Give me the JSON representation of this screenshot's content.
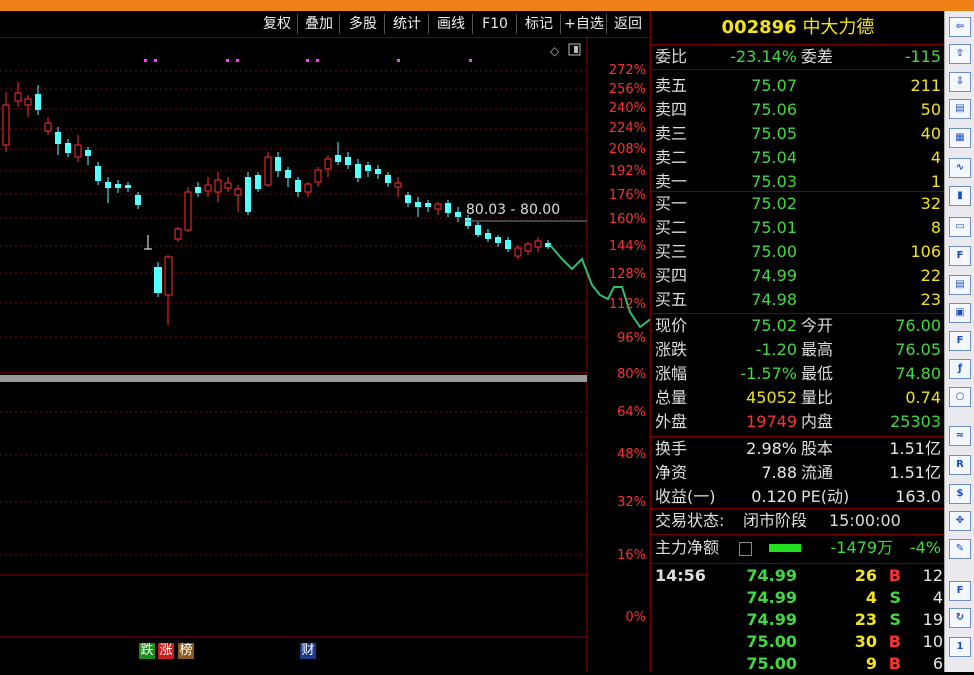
{
  "toolbar": {
    "buttons": [
      "复权",
      "叠加",
      "多股",
      "统计",
      "画线",
      "F10",
      "标记",
      "+自选",
      "返回"
    ]
  },
  "chart": {
    "price_label": "80.03 - 80.00",
    "axis_labels": [
      "272%",
      "256%",
      "240%",
      "224%",
      "208%",
      "192%",
      "176%",
      "160%",
      "144%",
      "128%",
      "112%",
      "96%",
      "80%",
      "64%",
      "48%",
      "32%",
      "16%",
      "0%"
    ],
    "markers": [
      "跌",
      "涨",
      "榜",
      "财"
    ]
  },
  "quote": {
    "code": "002896",
    "name": "中大力德",
    "weibi_label": "委比",
    "weibi_value": "-23.14%",
    "weicha_label": "委差",
    "weicha_value": "-115",
    "sells": [
      {
        "label": "卖五",
        "price": "75.07",
        "vol": "211"
      },
      {
        "label": "卖四",
        "price": "75.06",
        "vol": "50"
      },
      {
        "label": "卖三",
        "price": "75.05",
        "vol": "40"
      },
      {
        "label": "卖二",
        "price": "75.04",
        "vol": "4"
      },
      {
        "label": "卖一",
        "price": "75.03",
        "vol": "1"
      }
    ],
    "buys": [
      {
        "label": "买一",
        "price": "75.02",
        "vol": "32"
      },
      {
        "label": "买二",
        "price": "75.01",
        "vol": "8"
      },
      {
        "label": "买三",
        "price": "75.00",
        "vol": "106"
      },
      {
        "label": "买四",
        "price": "74.99",
        "vol": "22"
      },
      {
        "label": "买五",
        "price": "74.98",
        "vol": "23"
      }
    ],
    "stats": [
      {
        "l1": "现价",
        "v1": "75.02",
        "c1": "green",
        "l2": "今开",
        "v2": "76.00",
        "c2": "green"
      },
      {
        "l1": "涨跌",
        "v1": "-1.20",
        "c1": "green",
        "l2": "最高",
        "v2": "76.05",
        "c2": "green"
      },
      {
        "l1": "涨幅",
        "v1": "-1.57%",
        "c1": "green",
        "l2": "最低",
        "v2": "74.80",
        "c2": "green"
      },
      {
        "l1": "总量",
        "v1": "45052",
        "c1": "yellow",
        "l2": "量比",
        "v2": "0.74",
        "c2": "yellow"
      },
      {
        "l1": "外盘",
        "v1": "19749",
        "c1": "red",
        "l2": "内盘",
        "v2": "25303",
        "c2": "green"
      }
    ],
    "stats2": [
      {
        "l1": "换手",
        "v1": "2.98%",
        "l2": "股本",
        "v2": "1.51亿"
      },
      {
        "l1": "净资",
        "v1": "7.88",
        "l2": "流通",
        "v2": "1.51亿"
      },
      {
        "l1": "收益(一)",
        "v1": "0.120",
        "l2": "PE(动)",
        "v2": "163.0"
      }
    ],
    "trade_state_label": "交易状态:",
    "trade_state": "闭市阶段",
    "trade_time": "15:00:00",
    "main_net_label": "主力净额",
    "main_net_value": "-1479万",
    "main_net_pct": "-4%"
  },
  "ticks": [
    {
      "time": "14:56",
      "price": "74.99",
      "vol": "26",
      "side": "B",
      "n": "12"
    },
    {
      "time": "",
      "price": "74.99",
      "vol": "4",
      "side": "S",
      "n": "4"
    },
    {
      "time": "",
      "price": "74.99",
      "vol": "23",
      "side": "S",
      "n": "19"
    },
    {
      "time": "",
      "price": "75.00",
      "vol": "30",
      "side": "B",
      "n": "10"
    },
    {
      "time": "",
      "price": "75.00",
      "vol": "9",
      "side": "B",
      "n": "6"
    }
  ],
  "colors": {
    "up": "#ff3030",
    "down": "#41d941",
    "candle_down": "#54ffff",
    "accent": "#f2e31a"
  },
  "icons": [
    "arrow-left-icon",
    "arrow-up-icon",
    "arrow-down-icon",
    "stock-info-icon",
    "grid-icon",
    "line-chart-icon",
    "candlestick-icon",
    "window-icon",
    "f10-icon",
    "doc-icon",
    "monitor-icon",
    "f12-icon",
    "fx-icon",
    "circle-icon",
    "wave-icon",
    "rsi-icon",
    "dollar-icon",
    "move-icon",
    "pencil-icon",
    "f5-icon",
    "refresh-icon",
    "one-icon"
  ]
}
